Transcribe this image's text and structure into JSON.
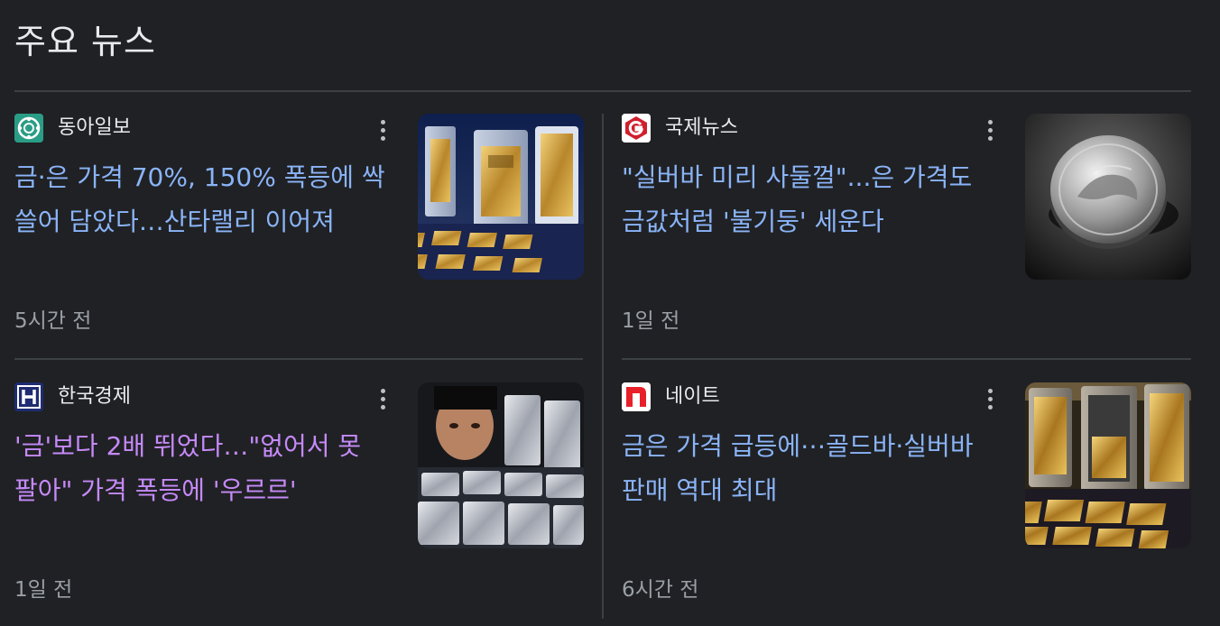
{
  "section": {
    "title": "주요 뉴스"
  },
  "articles": [
    {
      "source": "동아일보",
      "source_icon": "donga-logo-icon",
      "headline": "금·은 가격 70%, 150% 폭등에 싹 쓸어 담았다…산타랠리 이어져",
      "time": "5시간 전",
      "visited": false,
      "thumbnail": "gold-bars-image"
    },
    {
      "source": "국제뉴스",
      "source_icon": "gukje-logo-icon",
      "headline": "\"실버바 미리 사둘껄\"...은 가격도 금값처럼 '불기둥' 세운다",
      "time": "1일 전",
      "visited": false,
      "thumbnail": "silver-coin-image"
    },
    {
      "source": "한국경제",
      "source_icon": "hankyung-logo-icon",
      "headline": "'금'보다 2배 뛰었다…\"없어서 못 팔아\" 가격 폭등에 '우르르'",
      "time": "1일 전",
      "visited": true,
      "thumbnail": "silver-bars-image"
    },
    {
      "source": "네이트",
      "source_icon": "nate-logo-icon",
      "headline": "금은 가격 급등에⋯골드바·실버바 판매 역대 최대",
      "time": "6시간 전",
      "visited": false,
      "thumbnail": "gold-silver-bars-image"
    }
  ],
  "colors": {
    "background": "#202124",
    "headline_link": "#8ab4f8",
    "headline_visited": "#c58af9",
    "divider": "#3c4043",
    "meta_text": "#9aa0a6"
  }
}
